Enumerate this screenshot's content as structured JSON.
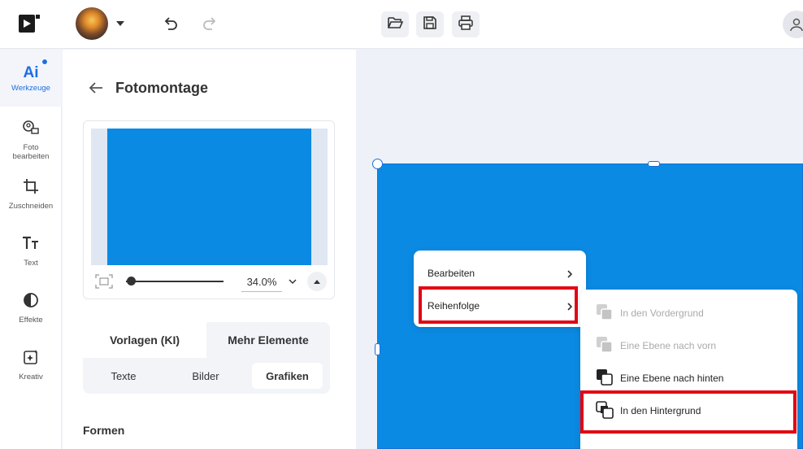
{
  "header": {
    "app_icon": "app-logo-icon",
    "undo_icon": "undo-icon",
    "redo_icon": "redo-icon",
    "file_buttons": [
      "folder-open-icon",
      "save-icon",
      "print-icon"
    ],
    "user_icon": "user-icon"
  },
  "rail": {
    "ai": {
      "glyph": "Ai",
      "label": "Werkzeuge"
    },
    "items": [
      {
        "label": "Foto bearbeiten",
        "icon": "photo-edit-icon"
      },
      {
        "label": "Zuschneiden",
        "icon": "crop-icon"
      },
      {
        "label": "Text",
        "icon": "text-icon"
      },
      {
        "label": "Effekte",
        "icon": "effects-icon"
      },
      {
        "label": "Kreativ",
        "icon": "creative-icon"
      }
    ]
  },
  "panel": {
    "title": "Fotomontage",
    "zoom": "34.0%",
    "tabs": [
      "Vorlagen (KI)",
      "Mehr Elemente"
    ],
    "active_tab": "Mehr Elemente",
    "subtabs": [
      "Texte",
      "Bilder",
      "Grafiken"
    ],
    "active_subtab": "Grafiken",
    "section": "Formen"
  },
  "context_menu": {
    "items": [
      "Bearbeiten",
      "Reihenfolge"
    ],
    "submenu": [
      {
        "label": "In den Vordergrund",
        "enabled": false
      },
      {
        "label": "Eine Ebene nach vorn",
        "enabled": false
      },
      {
        "label": "Eine Ebene nach hinten",
        "enabled": true
      },
      {
        "label": "In den Hintergrund",
        "enabled": true
      }
    ]
  },
  "colors": {
    "accent": "#1d6fe0",
    "canvas_fill": "#0b8ae3",
    "highlight": "#e30613"
  }
}
